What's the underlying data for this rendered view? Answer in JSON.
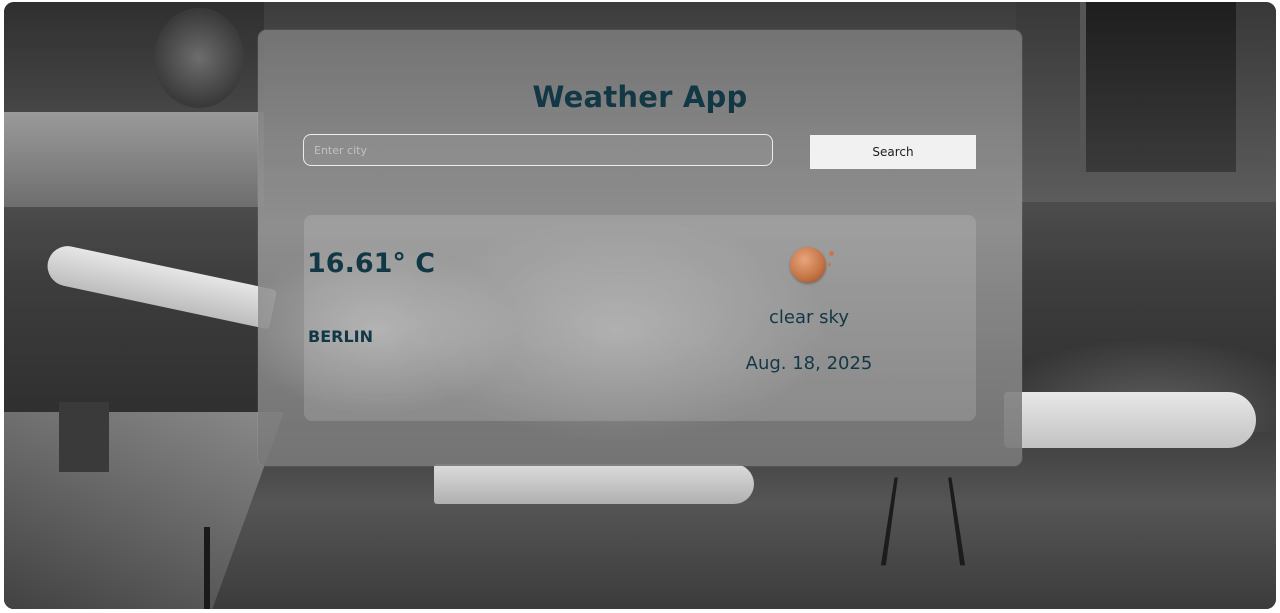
{
  "app": {
    "title": "Weather App"
  },
  "search": {
    "placeholder": "Enter city",
    "value": "",
    "button_label": "Search"
  },
  "weather": {
    "temperature": "16.61° C",
    "city": "BERLIN",
    "description": "clear sky",
    "date": "Aug. 18, 2025",
    "icon": "sun-icon"
  },
  "colors": {
    "text_primary": "#123845",
    "button_background": "#f1f1f1",
    "icon_sun": "#c67748"
  }
}
